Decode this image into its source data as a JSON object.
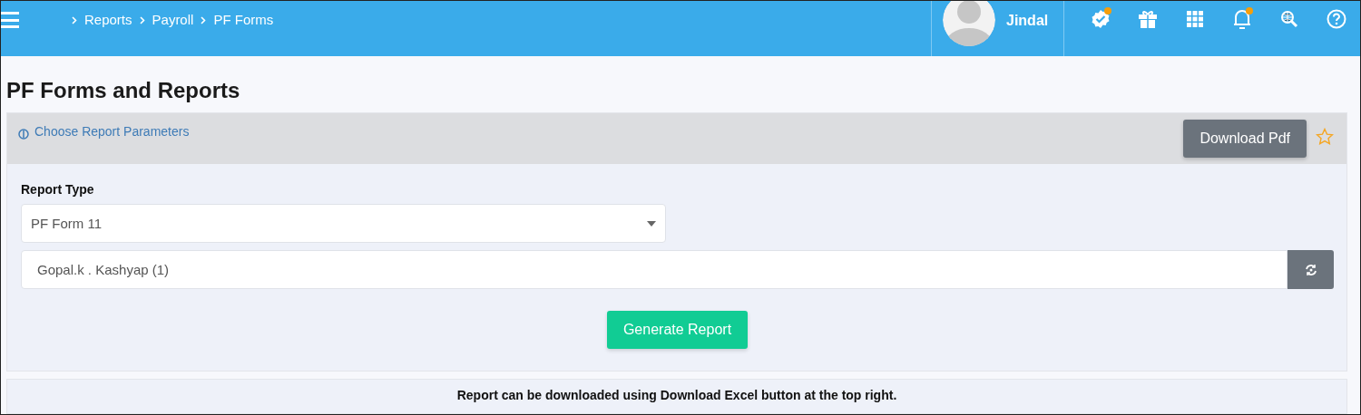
{
  "header": {
    "breadcrumbs": [
      "Reports",
      "Payroll",
      "PF Forms"
    ],
    "user": {
      "name": "Jindal"
    },
    "icons": [
      {
        "kind": "verified",
        "badge": true
      },
      {
        "kind": "gift",
        "badge": false
      },
      {
        "kind": "apps",
        "badge": false
      },
      {
        "kind": "bell",
        "badge": true
      },
      {
        "kind": "globe-search",
        "badge": false
      },
      {
        "kind": "help",
        "badge": false
      }
    ]
  },
  "page_title": "PF Forms and Reports",
  "panel": {
    "heading": "Choose Report Parameters",
    "download_button": "Download Pdf",
    "favorite": false,
    "report_type": {
      "label": "Report Type",
      "value": "PF Form 11"
    },
    "employee": {
      "value": "Gopal.k . Kashyap (1)"
    },
    "generate_button": "Generate Report"
  },
  "note": "Report can be downloaded using Download Excel button at the top right."
}
